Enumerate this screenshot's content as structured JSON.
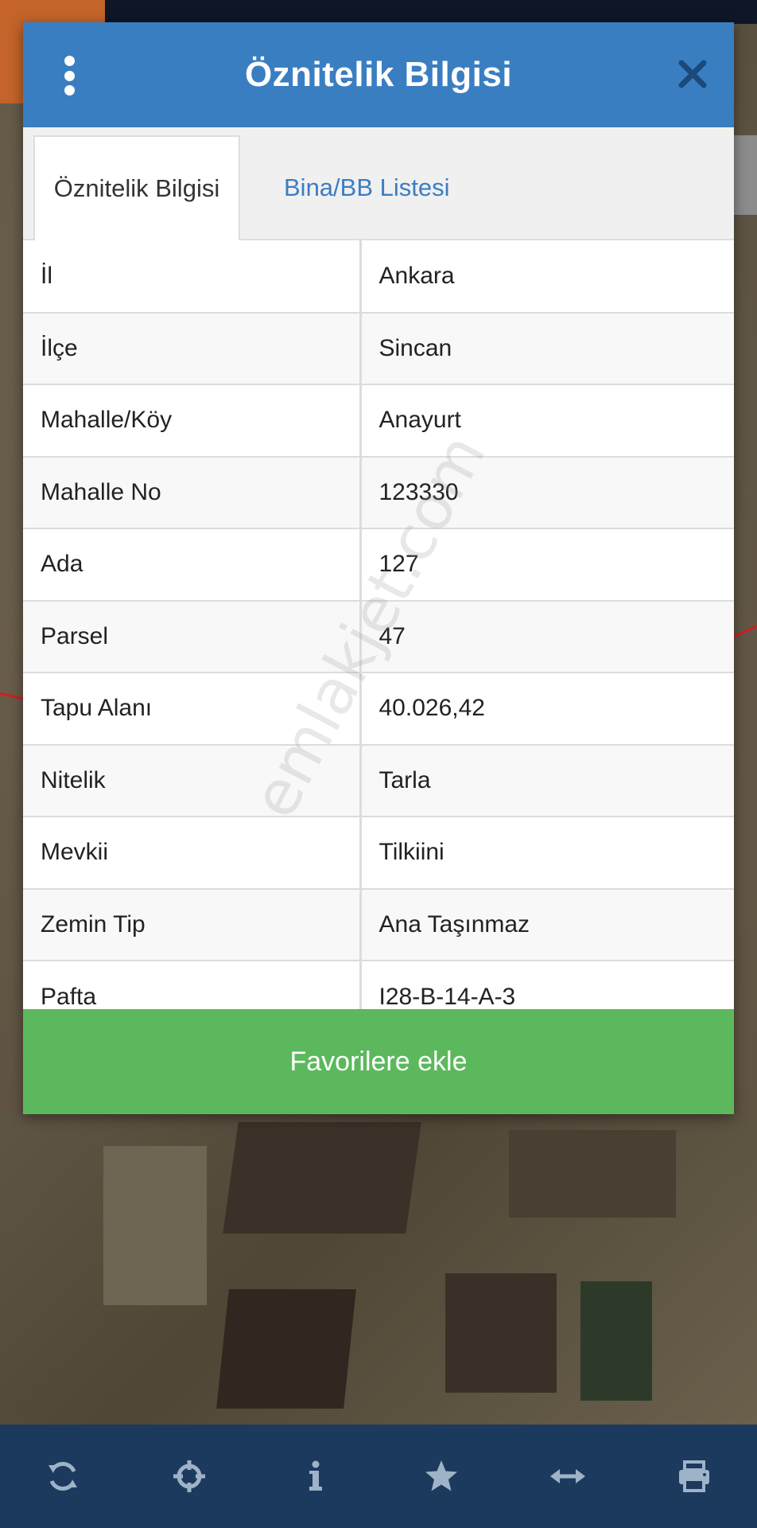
{
  "modal": {
    "title": "Öznitelik Bilgisi",
    "menu_icon": "kebab-menu-icon",
    "close_icon": "close-icon"
  },
  "tabs": [
    {
      "label": "Öznitelik Bilgisi",
      "active": true
    },
    {
      "label": "Bina/BB Listesi",
      "active": false
    }
  ],
  "attributes": [
    {
      "key": "İl",
      "value": "Ankara"
    },
    {
      "key": "İlçe",
      "value": "Sincan"
    },
    {
      "key": "Mahalle/Köy",
      "value": "Anayurt"
    },
    {
      "key": "Mahalle No",
      "value": "123330"
    },
    {
      "key": "Ada",
      "value": "127"
    },
    {
      "key": "Parsel",
      "value": "47"
    },
    {
      "key": "Tapu Alanı",
      "value": "40.026,42"
    },
    {
      "key": "Nitelik",
      "value": "Tarla"
    },
    {
      "key": "Mevkii",
      "value": "Tilkiini"
    },
    {
      "key": "Zemin Tip",
      "value": "Ana Taşınmaz"
    },
    {
      "key": "Pafta",
      "value": "I28-B-14-A-3"
    }
  ],
  "favorite_button": {
    "label": "Favorilere ekle"
  },
  "watermark": "emlakjet.com",
  "toolbar": {
    "icons": [
      "refresh-icon",
      "crosshair-icon",
      "info-icon",
      "star-icon",
      "measure-icon",
      "print-icon"
    ]
  },
  "colors": {
    "header": "#3a7ec2",
    "button": "#5cb85c",
    "toolbar": "#1c3a5e",
    "tab_link": "#3a7ec2"
  }
}
